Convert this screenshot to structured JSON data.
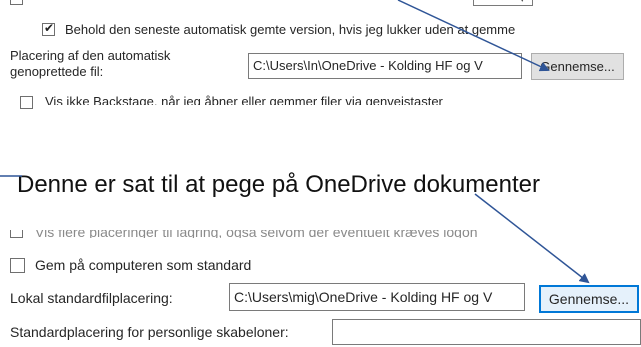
{
  "top_panel": {
    "cut_row_text": "",
    "keep_version": {
      "checked": true,
      "label": "Behold den seneste automatisk gemte version, hvis jeg lukker uden at gemme"
    },
    "autorecover": {
      "label_line1": "Placering af den automatisk",
      "label_line2": "genoprettede fil:",
      "path": "C:\\Users\\In\\OneDrive - Kolding HF og V",
      "browse_label": "Gennemse..."
    },
    "backstage": {
      "checked": false,
      "label": "Vis ikke Backstage, når jeg åbner eller gemmer filer via genvejstaster"
    }
  },
  "caption": "Denne er sat til at pege på OneDrive dokumenter",
  "bottom_panel": {
    "cut_row_text": "Vis flere placeringer til lagring, også selvom der eventuelt kræves logon",
    "save_computer": {
      "checked": false,
      "label": "Gem på computeren som standard"
    },
    "local_location": {
      "label": "Lokal standardfilplacering:",
      "path": "C:\\Users\\mig\\OneDrive - Kolding HF og V",
      "browse_label": "Gennemse..."
    },
    "templates": {
      "label": "Standardplacering for personlige skabeloner:",
      "path": ""
    }
  },
  "colors": {
    "annotation": "#2f5597",
    "focus_border": "#0078d7",
    "button_bg": "#e1e1e1"
  }
}
